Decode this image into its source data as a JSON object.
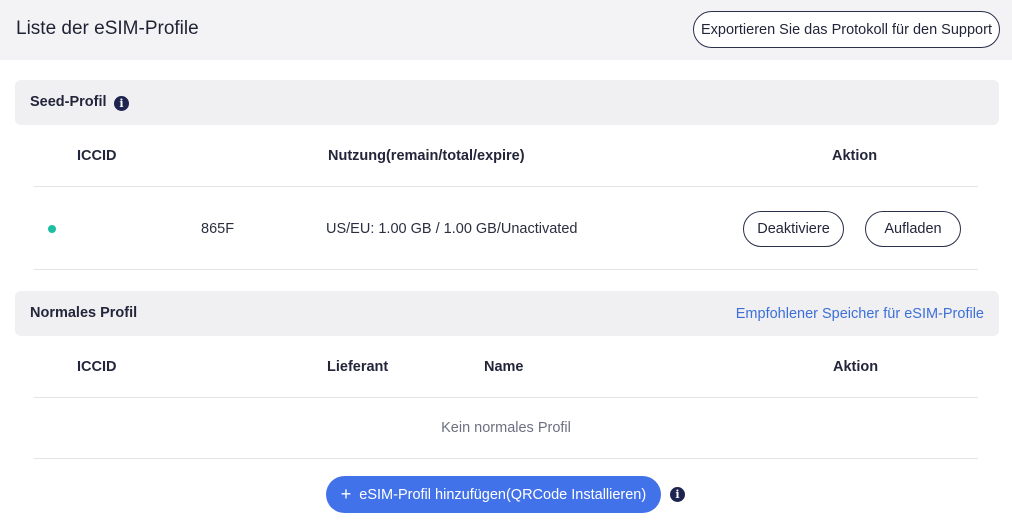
{
  "header": {
    "title": "Liste der eSIM-Profile",
    "export_label": "Exportieren Sie das Protokoll für den Support"
  },
  "seed": {
    "title": "Seed-Profil",
    "columns": [
      "ICCID",
      "Nutzung(remain/total/expire)",
      "Aktion"
    ],
    "row": {
      "status_color": "#1cbfa1",
      "iccid": "865F",
      "usage": "US/EU: 1.00 GB / 1.00 GB/Unactivated",
      "deactivate_label": "Deaktiviere",
      "recharge_label": "Aufladen"
    }
  },
  "normal": {
    "title": "Normales Profil",
    "link": "Empfohlener Speicher für eSIM-Profile",
    "columns": [
      "ICCID",
      "Lieferant",
      "Name",
      "Aktion"
    ],
    "empty": "Kein normales Profil"
  },
  "add_button": {
    "icon": "plus-icon",
    "label": "eSIM-Profil hinzufügen(QRCode Installieren)"
  },
  "colors": {
    "accent": "#4272ea",
    "link": "#3d6fd8",
    "status_active": "#1cbfa1"
  }
}
